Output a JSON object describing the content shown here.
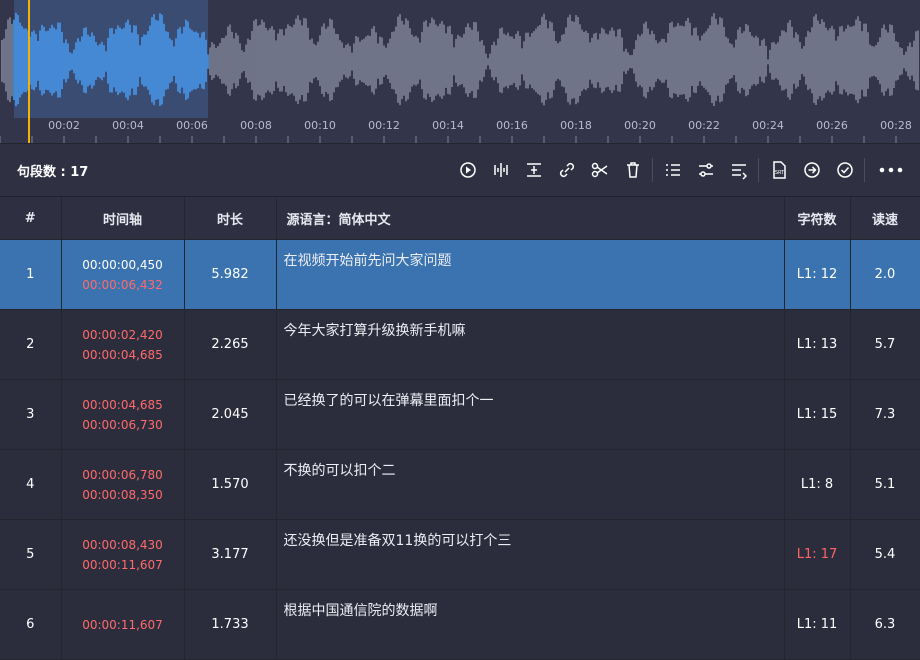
{
  "waveform": {
    "tick_labels": [
      "00:02",
      "00:04",
      "00:06",
      "00:08",
      "00:10",
      "00:12",
      "00:14",
      "00:16",
      "00:18",
      "00:20",
      "00:22",
      "00:24",
      "00:26",
      "00:28"
    ],
    "selection_color": "#4aa3ff"
  },
  "toolbar": {
    "segment_count": "句段数 : 17",
    "icons": [
      "play-segment-icon",
      "split-waveform-icon",
      "align-center-icon",
      "link-icon",
      "scissors-icon",
      "trash-icon",
      "sort-icon",
      "sliders-icon",
      "list-merge-icon",
      "srt-file-icon",
      "next-arrow-icon",
      "check-circle-icon",
      "more-icon"
    ]
  },
  "table": {
    "headers": {
      "num": "#",
      "timeline": "时间轴",
      "duration": "时长",
      "source": "源语言：简体中文",
      "chars": "字符数",
      "speed": "读速"
    },
    "rows": [
      {
        "num": "1",
        "start": "00:00:00,450",
        "end": "00:00:06,432",
        "duration": "5.982",
        "text": "在视频开始前先问大家问题",
        "chars": "L1: 12",
        "speed": "2.0"
      },
      {
        "num": "2",
        "start": "00:00:02,420",
        "end": "00:00:04,685",
        "duration": "2.265",
        "text": "今年大家打算升级换新手机嘛",
        "chars": "L1: 13",
        "speed": "5.7"
      },
      {
        "num": "3",
        "start": "00:00:04,685",
        "end": "00:00:06,730",
        "duration": "2.045",
        "text": "已经换了的可以在弹幕里面扣个一",
        "chars": "L1: 15",
        "speed": "7.3"
      },
      {
        "num": "4",
        "start": "00:00:06,780",
        "end": "00:00:08,350",
        "duration": "1.570",
        "text": "不换的可以扣个二",
        "chars": "L1: 8",
        "speed": "5.1"
      },
      {
        "num": "5",
        "start": "00:00:08,430",
        "end": "00:00:11,607",
        "duration": "3.177",
        "text": "还没换但是准备双11换的可以打个三",
        "chars": "L1: 17",
        "speed": "5.4"
      },
      {
        "num": "6",
        "start": "00:00:11,607",
        "end": "",
        "duration": "1.733",
        "text": "根据中国通信院的数据啊",
        "chars": "L1: 11",
        "speed": "6.3"
      }
    ]
  }
}
